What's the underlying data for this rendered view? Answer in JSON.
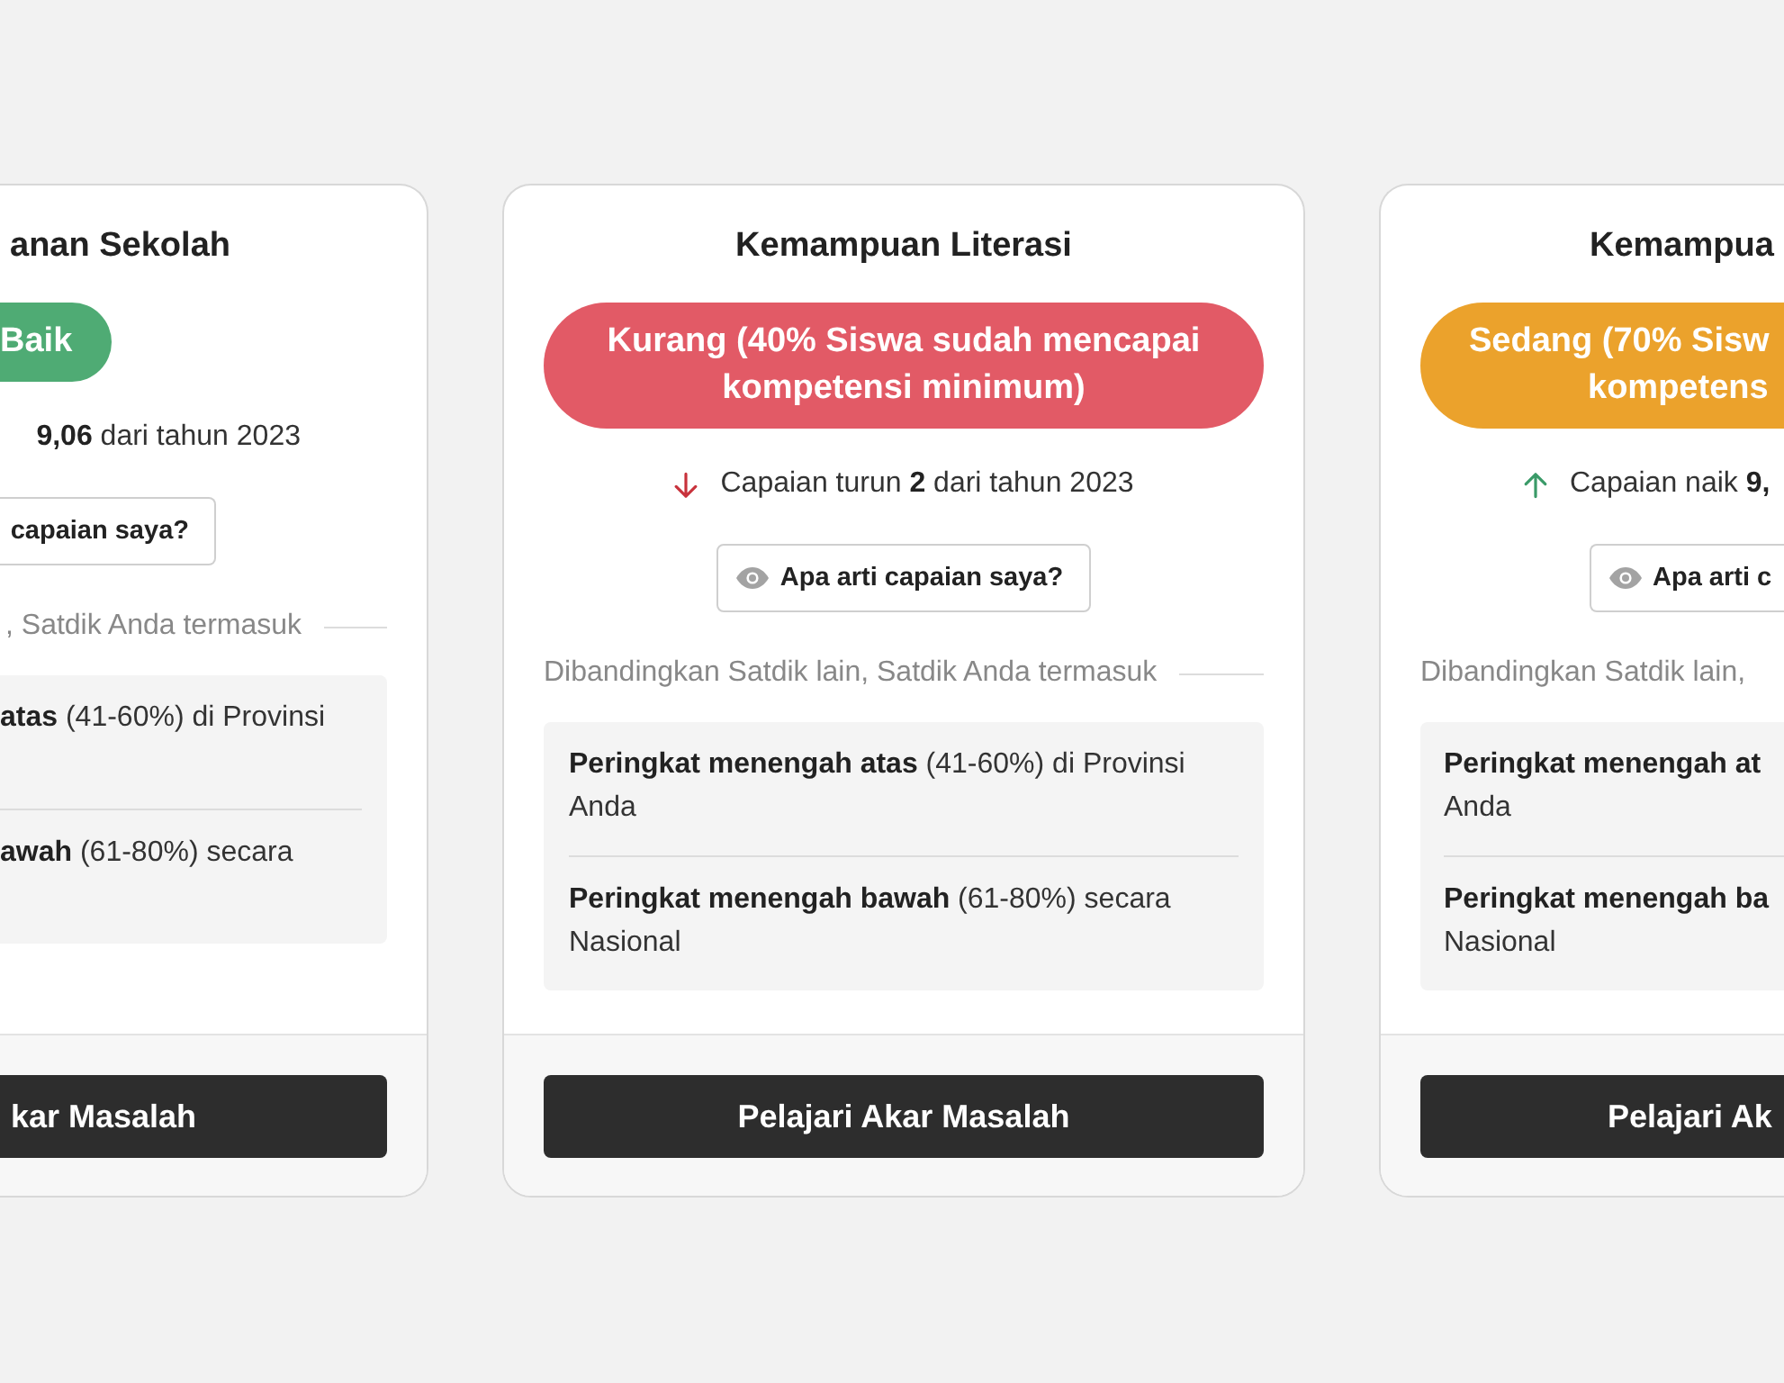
{
  "cards": [
    {
      "title": "anan Sekolah",
      "status": {
        "lines": [
          "Baik"
        ],
        "color": "#4fab74"
      },
      "change": {
        "text": "**9,06** dari tahun 2023"
      },
      "info_button": "capaian saya?",
      "comparison": {
        "label": ", Satdik Anda termasuk",
        "ranks": [
          {
            "lines": [
              "**atas** (41-60%) di Provinsi"
            ]
          },
          {
            "lines": [
              "**awah** (61-80%) secara"
            ]
          }
        ]
      },
      "action_button": "kar Masalah"
    },
    {
      "title": "Kemampuan Literasi",
      "status": {
        "lines": [
          "Kurang (40% Siswa sudah mencapai",
          "kompetensi minimum)"
        ],
        "color": "#e25a66"
      },
      "change": {
        "kind": "decrease",
        "text": "Capaian turun **2** dari tahun 2023"
      },
      "info_button": "Apa arti capaian saya?",
      "comparison": {
        "label": "Dibandingkan Satdik lain, Satdik Anda termasuk",
        "ranks": [
          {
            "lines": [
              "**Peringkat menengah atas** (41-60%) di Provinsi",
              "Anda"
            ]
          },
          {
            "lines": [
              "**Peringkat menengah bawah** (61-80%) secara",
              "Nasional"
            ]
          }
        ]
      },
      "action_button": "Pelajari Akar Masalah"
    },
    {
      "title": "Kemampua",
      "status": {
        "lines": [
          "Sedang (70% Sisw",
          "kompetens"
        ],
        "color": "#eba22c"
      },
      "change": {
        "kind": "increase",
        "text": "Capaian naik **9,**"
      },
      "info_button": "Apa arti c",
      "comparison": {
        "label": "Dibandingkan Satdik lain,",
        "ranks": [
          {
            "lines": [
              "**Peringkat menengah at**",
              "Anda"
            ]
          },
          {
            "lines": [
              "**Peringkat menengah ba**",
              "Nasional"
            ]
          }
        ]
      },
      "action_button": "Pelajari Ak"
    }
  ]
}
